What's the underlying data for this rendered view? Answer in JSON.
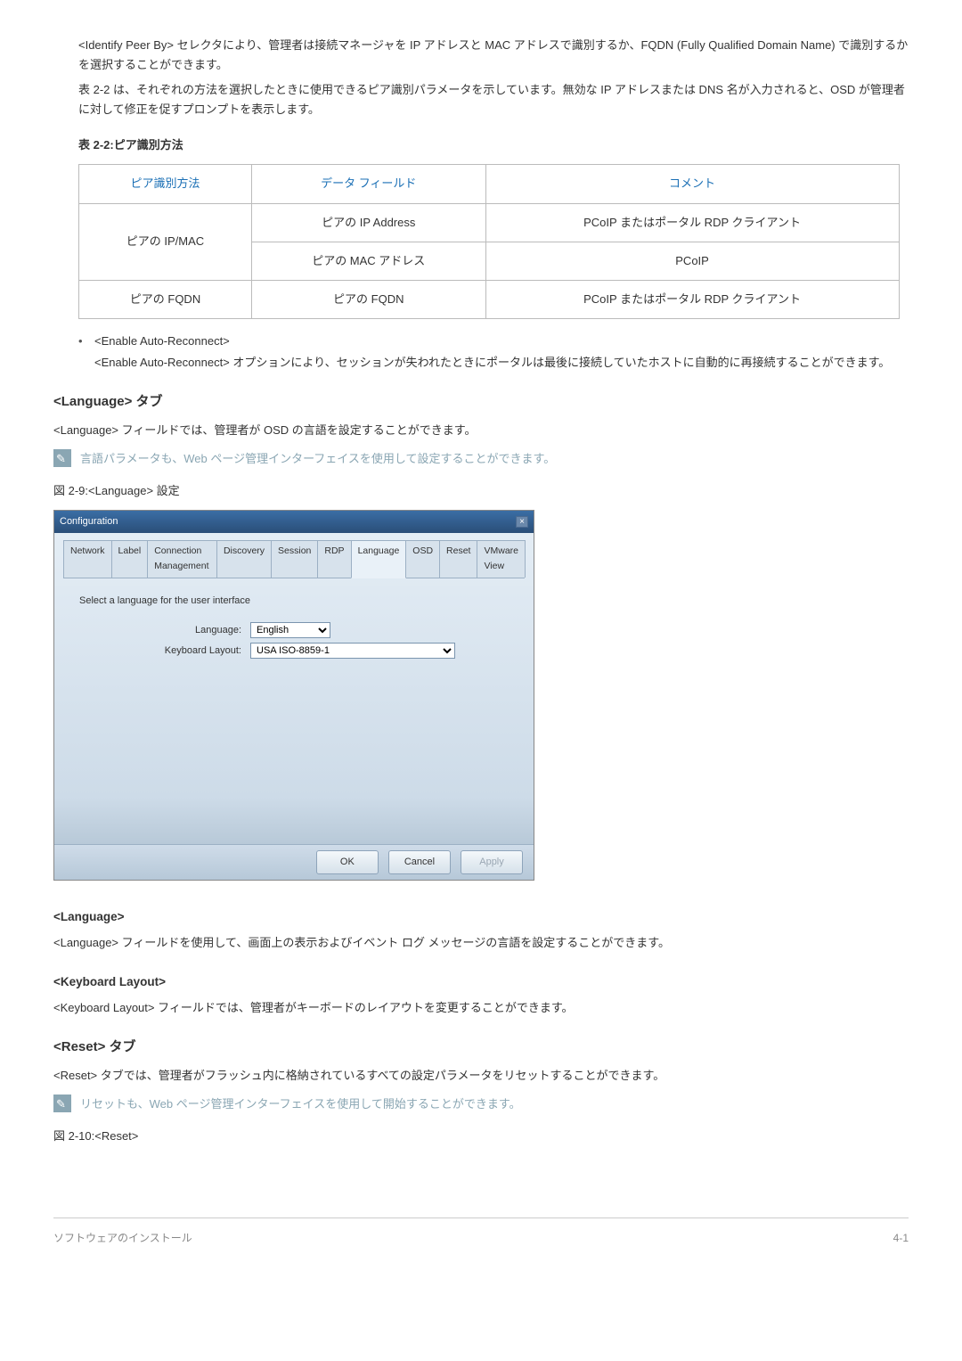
{
  "intro": {
    "p1": "<Identify Peer By> セレクタにより、管理者は接続マネージャを IP アドレスと MAC アドレスで識別するか、FQDN (Fully Qualified Domain Name) で識別するかを選択することができます。",
    "p2": "表 2-2 は、それぞれの方法を選択したときに使用できるピア識別パラメータを示しています。無効な IP アドレスまたは DNS 名が入力されると、OSD が管理者に対して修正を促すプロンプトを表示します。"
  },
  "table": {
    "title": "表 2-2:ピア識別方法",
    "headers": {
      "c1": "ピア識別方法",
      "c2": "データ フィールド",
      "c3": "コメント"
    },
    "r1c1": "ピアの IP/MAC",
    "r1c2": "ピアの IP Address",
    "r1c3": "PCoIP またはポータル RDP クライアント",
    "r2c2": "ピアの MAC アドレス",
    "r2c3": "PCoIP",
    "r3c1": "ピアの FQDN",
    "r3c2": "ピアの FQDN",
    "r3c3": "PCoIP またはポータル RDP クライアント"
  },
  "bullets": {
    "ear_title": "<Enable Auto-Reconnect>",
    "ear_text": "<Enable Auto-Reconnect> オプションにより、セッションが失われたときにポータルは最後に接続していたホストに自動的に再接続することができます。"
  },
  "lang": {
    "heading": "<Language> タブ",
    "p1": "<Language> フィールドでは、管理者が OSD の言語を設定することができます。",
    "note": "言語パラメータも、Web ページ管理インターフェイスを使用して設定することができます。",
    "fig_cap": "図 2-9:<Language> 設定"
  },
  "dialog": {
    "title": "Configuration",
    "tabs": [
      "Network",
      "Label",
      "Connection Management",
      "Discovery",
      "Session",
      "RDP",
      "Language",
      "OSD",
      "Reset",
      "VMware View"
    ],
    "active_tab_index": 6,
    "select_label": "Select a language for the user interface",
    "row1": {
      "label": "Language:",
      "value": "English"
    },
    "row2": {
      "label": "Keyboard Layout:",
      "value": "USA ISO-8859-1"
    },
    "buttons": {
      "ok": "OK",
      "cancel": "Cancel",
      "apply": "Apply"
    }
  },
  "lang2": {
    "heading": "<Language>",
    "text": "<Language> フィールドを使用して、画面上の表示およびイベント ログ メッセージの言語を設定することができます。"
  },
  "kbd": {
    "heading": "<Keyboard Layout>",
    "text": "<Keyboard Layout> フィールドでは、管理者がキーボードのレイアウトを変更することができます。"
  },
  "reset": {
    "heading": "<Reset> タブ",
    "text": "<Reset> タブでは、管理者がフラッシュ内に格納されているすべての設定パラメータをリセットすることができます。",
    "note": "リセットも、Web ページ管理インターフェイスを使用して開始することができます。",
    "fig_cap": "図 2-10:<Reset>"
  },
  "footer": {
    "left": "ソフトウェアのインストール",
    "right": "4-1"
  }
}
